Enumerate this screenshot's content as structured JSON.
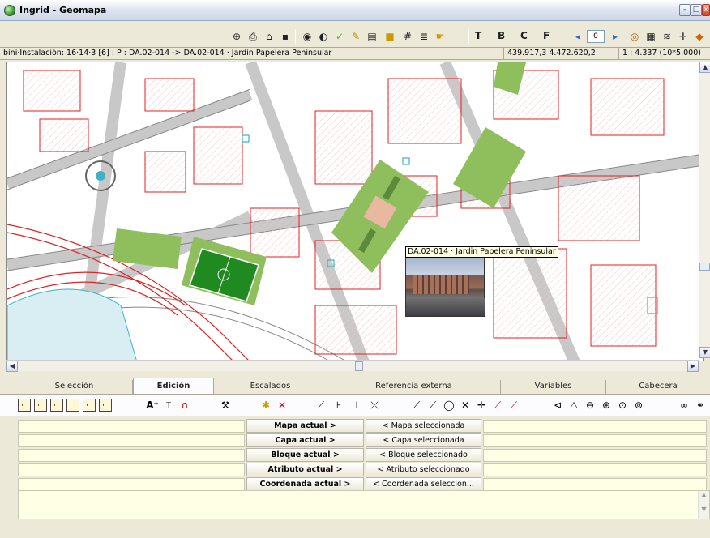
{
  "window": {
    "title": "Ingrid - Geomapa"
  },
  "toolbar": {
    "buttons": [
      {
        "name": "zoom-target-icon",
        "glyph": "⊕"
      },
      {
        "name": "print-icon",
        "glyph": "⎙"
      },
      {
        "name": "tools-icon",
        "glyph": "⌂"
      },
      {
        "name": "save-icon",
        "glyph": "▪"
      },
      {
        "name": "eye-icon",
        "glyph": "◉"
      },
      {
        "name": "contrast-icon",
        "glyph": "◐"
      },
      {
        "name": "pencil-check-icon",
        "glyph": "✓"
      },
      {
        "name": "pencil-star-icon",
        "glyph": "✎"
      },
      {
        "name": "page-icon",
        "glyph": "▤"
      },
      {
        "name": "color-icon",
        "glyph": "■"
      },
      {
        "name": "grid-icon",
        "glyph": "#"
      },
      {
        "name": "table-icon",
        "glyph": "≣"
      },
      {
        "name": "hand-icon",
        "glyph": "☛"
      }
    ],
    "menus": [
      "T",
      "B",
      "C",
      "F"
    ],
    "page_value": "0",
    "right_icons": [
      "target-icon",
      "list-icon",
      "layers-icon",
      "crosshair-icon",
      "eraser-icon"
    ]
  },
  "status": {
    "info": "bini·Instalación: 16·14·3 [6] : P : DA.02-014 -> DA.02-014 · Jardin Papelera Peninsular",
    "coords": "439.917,3  4.472.620,2",
    "scale": "1 : 4.337 (10*5.000)"
  },
  "map": {
    "tooltip": "DA.02-014 · Jardin Papelera Peninsular",
    "colors": {
      "green": "#8fbf5c",
      "field": "#1f8a1f",
      "red": "#e02020",
      "water": "#3fb0c8"
    }
  },
  "tabs": [
    {
      "label": "Selección",
      "active": false
    },
    {
      "label": "Edición",
      "active": true
    },
    {
      "label": "Escalados",
      "active": false
    },
    {
      "label": "Referencia externa",
      "active": false
    },
    {
      "label": "Variables",
      "active": false
    },
    {
      "label": "Cabecera",
      "active": false
    }
  ],
  "edit_tools": [
    "select-1-icon",
    "select-2-icon",
    "select-3-icon",
    "select-4-icon",
    "select-5-icon",
    "select-6-icon",
    "add-text-icon",
    "insert-icon",
    "magnet-icon",
    "wrench-icon",
    "spark-icon",
    "delete-icon",
    "node-1-icon",
    "node-2-icon",
    "node-3-icon",
    "node-4-icon",
    "line-1-icon",
    "line-2-icon",
    "circle-icon",
    "cross-icon",
    "break-icon",
    "brush-icon",
    "pen-icon",
    "align-icon",
    "mirror-icon",
    "rotate-1-icon",
    "rotate-2-icon",
    "rotate-3-icon",
    "rotate-4-icon",
    "link-icon",
    "binoculars-icon"
  ],
  "grid": {
    "rows": [
      {
        "left": "Mapa actual >",
        "mid": "< Mapa seleccionada"
      },
      {
        "left": "Capa actual >",
        "mid": "< Capa seleccionada"
      },
      {
        "left": "Bloque actual >",
        "mid": "< Bloque seleccionado"
      },
      {
        "left": "Atributo actual >",
        "mid": "< Atributo seleccionado"
      },
      {
        "left": "Coordenada actual >",
        "mid": "< Coordenada seleccion..."
      }
    ]
  }
}
